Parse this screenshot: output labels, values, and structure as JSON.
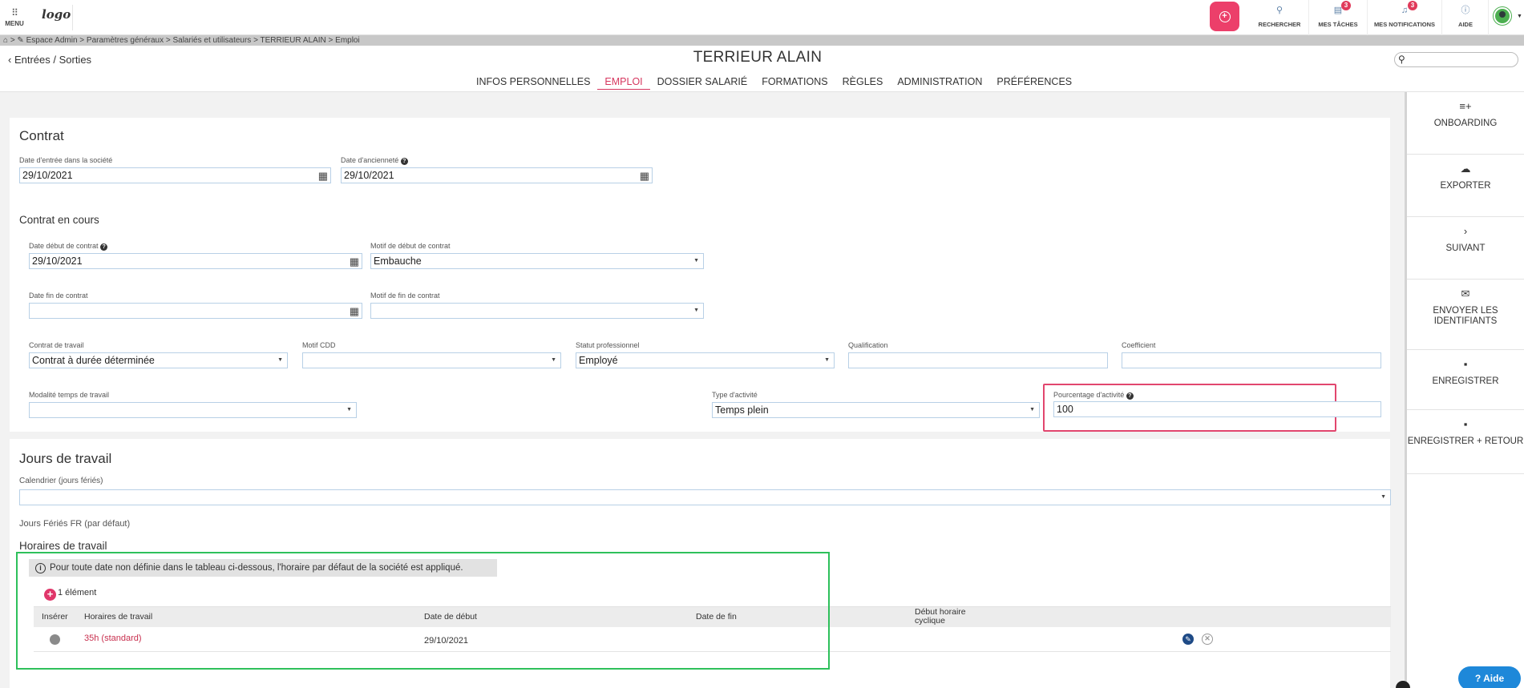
{
  "topbar": {
    "menu_label": "MENU",
    "logo_text": "logo",
    "items": [
      {
        "label": "RECHERCHER",
        "icon": "search-icon"
      },
      {
        "label": "MES TÂCHES",
        "icon": "tasks-icon",
        "badge": "3"
      },
      {
        "label": "MES NOTIFICATIONS",
        "icon": "bell-icon",
        "badge": "3"
      },
      {
        "label": "AIDE",
        "icon": "help-icon"
      }
    ]
  },
  "breadcrumb": "⌂ > ✎ Espace Admin > Paramètres généraux > Salariés et utilisateurs > TERRIEUR ALAIN > Emploi",
  "header": {
    "back_label": "Entrées / Sorties",
    "title": "TERRIEUR ALAIN",
    "tabs": [
      "INFOS PERSONNELLES",
      "EMPLOI",
      "DOSSIER SALARIÉ",
      "FORMATIONS",
      "RÈGLES",
      "ADMINISTRATION",
      "PRÉFÉRENCES"
    ],
    "active_tab": "EMPLOI"
  },
  "right_panel": [
    {
      "label": "ONBOARDING",
      "icon": "playlist-add-icon"
    },
    {
      "label": "EXPORTER",
      "icon": "cloud-upload-icon"
    },
    {
      "label": "SUIVANT",
      "icon": "chevron-right-icon"
    },
    {
      "label": "ENVOYER LES IDENTIFIANTS",
      "icon": "envelope-icon"
    },
    {
      "label": "ENREGISTRER",
      "icon": "save-icon"
    },
    {
      "label": "ENREGISTRER + RETOUR",
      "icon": "save-return-icon"
    }
  ],
  "contrat": {
    "title": "Contrat",
    "date_entree_label": "Date d'entrée dans la société",
    "date_entree": "29/10/2021",
    "date_anciennete_label": "Date d'ancienneté",
    "date_anciennete": "29/10/2021"
  },
  "contrat_en_cours": {
    "title": "Contrat en cours",
    "date_debut_label": "Date début de contrat",
    "date_debut": "29/10/2021",
    "motif_debut_label": "Motif de début de contrat",
    "motif_debut": "Embauche",
    "date_fin_label": "Date fin de contrat",
    "date_fin": "",
    "motif_fin_label": "Motif de fin de contrat",
    "motif_fin": "",
    "contrat_travail_label": "Contrat de travail",
    "contrat_travail": "Contrat à durée déterminée",
    "motif_cdd_label": "Motif CDD",
    "motif_cdd": "",
    "statut_label": "Statut professionnel",
    "statut": "Employé",
    "qualification_label": "Qualification",
    "qualification": "",
    "coefficient_label": "Coefficient",
    "coefficient": "",
    "modalite_label": "Modalité temps de travail",
    "modalite": "",
    "type_activite_label": "Type d'activité",
    "type_activite": "Temps plein",
    "pourcentage_label": "Pourcentage d'activité",
    "pourcentage": "100"
  },
  "jours": {
    "title": "Jours de travail",
    "calendrier_label": "Calendrier (jours fériés)",
    "calendrier": "",
    "feries_text": "Jours Fériés FR (par défaut)",
    "horaires_title": "Horaires de travail",
    "note": "Pour toute date non définie dans le tableau ci-dessous, l'horaire par défaut de la société est appliqué.",
    "count": "1 élément",
    "columns": [
      "Insérer",
      "Horaires de travail",
      "Date de début",
      "Date de fin",
      "Début horaire",
      "cyclique"
    ],
    "rows": [
      {
        "horaire": "35h (standard)",
        "date_debut": "29/10/2021",
        "date_fin": ""
      }
    ]
  },
  "aide_button": "Aide",
  "colors": {
    "accent": "#d6365e",
    "highlight_red": "#e2466e",
    "highlight_green": "#2ec05b",
    "aide_blue": "#1e88d9"
  }
}
